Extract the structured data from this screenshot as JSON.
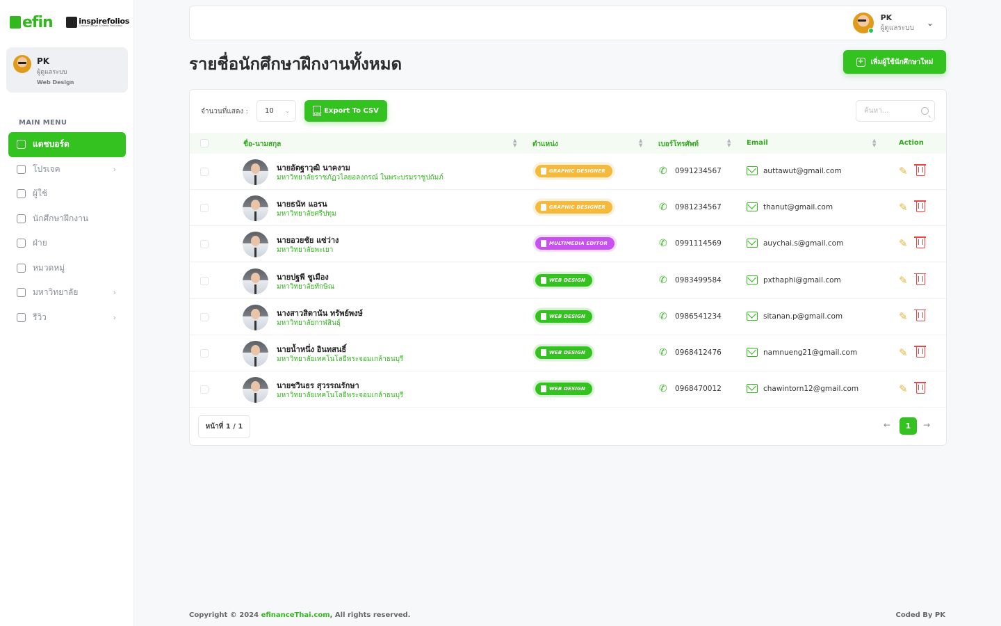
{
  "brand": {
    "logo": "efin",
    "partner": "inspirefolios",
    "partner_sub": "Creative Design & Media Production"
  },
  "sidebar": {
    "profile": {
      "name": "PK",
      "role": "ผู้ดูแลระบบ",
      "dept": "Web Design"
    },
    "menu_title": "MAIN MENU",
    "items": [
      {
        "label": "แดชบอร์ด",
        "icon": "home-icon",
        "active": true,
        "chevron": false
      },
      {
        "label": "โปรเจค",
        "icon": "project-icon",
        "active": false,
        "chevron": true
      },
      {
        "label": "ผู้ใช้",
        "icon": "user-card-icon",
        "active": false,
        "chevron": false
      },
      {
        "label": "นักศึกษาฝึกงาน",
        "icon": "users-icon",
        "active": false,
        "chevron": false
      },
      {
        "label": "ฝ่าย",
        "icon": "department-icon",
        "active": false,
        "chevron": false
      },
      {
        "label": "หมวดหมู่",
        "icon": "category-icon",
        "active": false,
        "chevron": false
      },
      {
        "label": "มหาวิทยาลัย",
        "icon": "university-icon",
        "active": false,
        "chevron": true
      },
      {
        "label": "รีวิว",
        "icon": "review-icon",
        "active": false,
        "chevron": true
      }
    ]
  },
  "header": {
    "user_name": "PK",
    "user_role": "ผู้ดูแลระบบ"
  },
  "page": {
    "title": "รายชื่อนักศึกษาฝึกงานทั้งหมด",
    "add_button": "เพิ่มผู้ใช้นักศึกษาใหม่"
  },
  "controls": {
    "show_label": "จำนวนที่แสดง :",
    "show_value": "10",
    "export_label": "Export To CSV",
    "search_placeholder": "ค้นหา..."
  },
  "table": {
    "headers": {
      "name": "ชื่อ-นามสกุล",
      "position": "ตำแหน่ง",
      "phone": "เบอร์โทรศัพท์",
      "email": "Email",
      "action": "Action"
    },
    "rows": [
      {
        "name": "นายอัตฐาวุฒิ นาคงาม",
        "university": "มหาวิทยาลัยราชภัฏวไลยอลงกรณ์ ในพระบรมราชูปถัมภ์",
        "position": "GRAPHIC DESIGNER",
        "badge_color": "#f5b93b",
        "phone": "0991234567",
        "email": "auttawut@gmail.com"
      },
      {
        "name": "นายธนัท แอรน",
        "university": "มหาวิทยาลัยศรีปทุม",
        "position": "GRAPHIC DESIGNER",
        "badge_color": "#f5b93b",
        "phone": "0981234567",
        "email": "thanut@gmail.com"
      },
      {
        "name": "นายอวยชัย แซ่ว่าง",
        "university": "มหาวิทยาลัยพะเยา",
        "position": "MULTIMEDIA EDITOR",
        "badge_color": "#c84ff0",
        "phone": "0991114569",
        "email": "auychai.s@gmail.com"
      },
      {
        "name": "นายปฐพี ชูเมือง",
        "university": "มหาวิทยาลัยทักษิณ",
        "position": "WEB DESIGN",
        "badge_color": "#33c21f",
        "phone": "0983499584",
        "email": "pxthaphi@gmail.com"
      },
      {
        "name": "นางสาวสิตานัน ทรัพย์พงษ์",
        "university": "มหาวิทยาลัยกาฬสินธุ์",
        "position": "WEB DESIGN",
        "badge_color": "#33c21f",
        "phone": "0986541234",
        "email": "sitanan.p@gmail.com"
      },
      {
        "name": "นายน้ำหนึ่ง อินทสนธิ์",
        "university": "มหาวิทยาลัยเทคโนโลยีพระจอมเกล้าธนบุรี",
        "position": "WEB DESIGN",
        "badge_color": "#33c21f",
        "phone": "0968412476",
        "email": "namnueng21@gmail.com"
      },
      {
        "name": "นายชวินธร สุวรรณรักษา",
        "university": "มหาวิทยาลัยเทคโนโลยีพระจอมเกล้าธนบุรี",
        "position": "WEB DESIGN",
        "badge_color": "#33c21f",
        "phone": "0968470012",
        "email": "chawintorn12@gmail.com"
      }
    ]
  },
  "pagination": {
    "info": "หน้าที่ 1 / 1",
    "current": "1"
  },
  "footer": {
    "copyright_prefix": "Copyright © 2024 ",
    "brand": "efinanceThai.com",
    "copyright_suffix": ", All rights reserved.",
    "credit": "Coded By PK"
  },
  "colors": {
    "accent": "#33c21f",
    "graphic": "#f5b93b",
    "multimedia": "#c84ff0"
  }
}
